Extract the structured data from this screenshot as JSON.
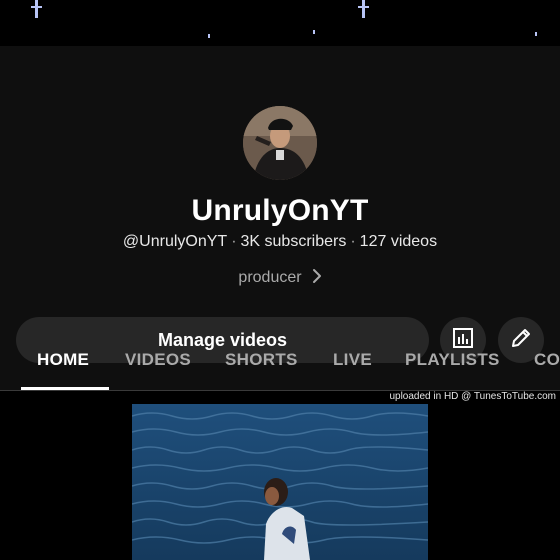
{
  "channel": {
    "name": "UnrulyOnYT",
    "handle": "@UnrulyOnYT",
    "subscribers": "3K subscribers",
    "video_count": "127 videos",
    "description": "producer"
  },
  "actions": {
    "manage_label": "Manage videos"
  },
  "tabs": [
    {
      "label": "HOME",
      "active": true
    },
    {
      "label": "VIDEOS",
      "active": false
    },
    {
      "label": "SHORTS",
      "active": false
    },
    {
      "label": "LIVE",
      "active": false
    },
    {
      "label": "PLAYLISTS",
      "active": false
    },
    {
      "label": "CO",
      "active": false
    }
  ],
  "featured": {
    "watermark": "uploaded in HD @ TunesToTube.com"
  },
  "colors": {
    "background": "#0f0f0f",
    "button": "#272727",
    "text": "#f1f1f1",
    "muted": "#aaaaaa"
  },
  "icons": [
    "analytics-icon",
    "pencil-icon",
    "chevron-right-icon"
  ]
}
